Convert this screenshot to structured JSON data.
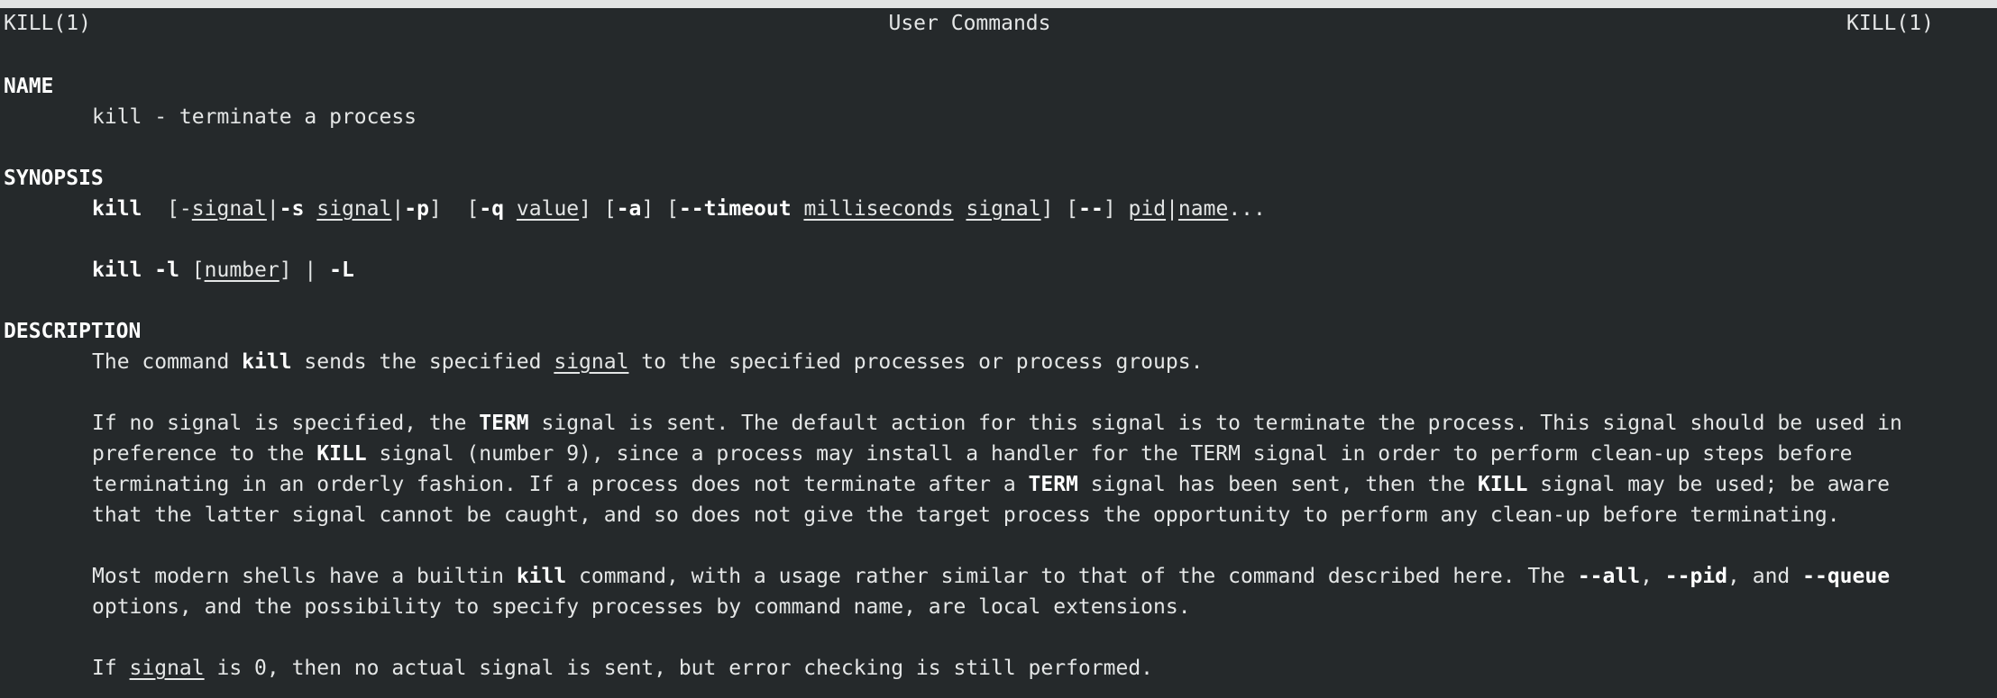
{
  "header": {
    "left": "KILL(1)",
    "center": "User Commands",
    "right": "KILL(1)"
  },
  "name_section": {
    "title": "NAME",
    "text": "kill - terminate a process"
  },
  "synopsis": {
    "title": "SYNOPSIS",
    "line1": {
      "cmd": "kill",
      "p1": "  [-",
      "signal1": "signal",
      "p2": "|",
      "opt_s": "-s",
      "p3": " ",
      "signal2": "signal",
      "p4": "|",
      "opt_p": "-p",
      "p5": "]  [",
      "opt_q": "-q",
      "p6": " ",
      "value": "value",
      "p7": "] [",
      "opt_a": "-a",
      "p8": "] [",
      "opt_timeout": "--timeout",
      "p9": " ",
      "milliseconds": "milliseconds",
      "p10": " ",
      "signal3": "signal",
      "p11": "] [",
      "opt_dashdash": "--",
      "p12": "] ",
      "pid": "pid",
      "p13": "|",
      "name": "name",
      "p14": "..."
    },
    "line2": {
      "cmd": "kill -l",
      "p1": " [",
      "number": "number",
      "p2": "] | ",
      "opt_L": "-L"
    }
  },
  "description": {
    "title": "DESCRIPTION",
    "para1": {
      "a": "The command ",
      "kill": "kill",
      "b": " sends the specified ",
      "signal": "signal",
      "c": " to the specified processes or process groups."
    },
    "para2": {
      "l1a": "If no signal is specified, the ",
      "l1term": "TERM",
      "l1b": " signal is sent. The default action for this signal is to terminate the process. This signal should be used in",
      "l2a": "preference to the ",
      "l2kill": "KILL",
      "l2b": " signal (number 9), since a process may install a handler for the TERM signal in order to perform clean-up steps before",
      "l3a": "terminating in an orderly fashion. If a process does not terminate after a ",
      "l3term": "TERM",
      "l3b": " signal has been sent, then the ",
      "l3kill": "KILL",
      "l3c": " signal may be used; be aware",
      "l4": "that the latter signal cannot be caught, and so does not give the target process the opportunity to perform any clean-up before terminating."
    },
    "para3": {
      "l1a": "Most modern shells have a builtin ",
      "l1kill": "kill",
      "l1b": " command, with a usage rather similar to that of the command described here. The ",
      "l1all": "--all",
      "l1c": ", ",
      "l1pid": "--pid",
      "l1d": ", and ",
      "l1queue": "--queue",
      "l2": "options, and the possibility to specify processes by command name, are local extensions."
    },
    "para4": {
      "a": "If ",
      "signal": "signal",
      "b": " is 0, then no actual signal is sent, but error checking is still performed."
    }
  }
}
